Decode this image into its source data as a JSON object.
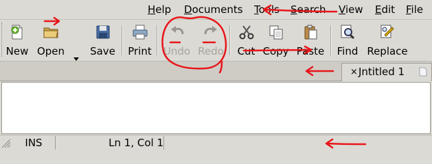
{
  "menubar": {
    "items": [
      {
        "label": "Help",
        "mnemonic": "H",
        "rest": "elp"
      },
      {
        "label": "Documents",
        "mnemonic": "D",
        "rest": "ocuments"
      },
      {
        "label": "Tools",
        "mnemonic": "T",
        "rest": "ools"
      },
      {
        "label": "Search",
        "mnemonic": "S",
        "rest": "earch"
      },
      {
        "label": "View",
        "mnemonic": "V",
        "rest": "iew"
      },
      {
        "label": "Edit",
        "mnemonic": "E",
        "rest": "dit"
      },
      {
        "label": "File",
        "mnemonic": "F",
        "rest": "ile"
      }
    ]
  },
  "toolbar": {
    "new_label": "New",
    "open_label": "Open",
    "save_label": "Save",
    "print_label": "Print",
    "undo_label": "Undo",
    "redo_label": "Redo",
    "cut_label": "Cut",
    "copy_label": "Copy",
    "paste_label": "Paste",
    "find_label": "Find",
    "replace_label": "Replace"
  },
  "tab": {
    "close_glyph": "×",
    "title": "Jntitled 1"
  },
  "statusbar": {
    "mode": "INS",
    "position": "Ln 1, Col 1"
  },
  "colors": {
    "annotation": "#e8161a",
    "window_bg": "#dcdad5",
    "editor_bg": "#ffffff",
    "disabled_text": "#a7a49c"
  },
  "icons": [
    "new-document-icon",
    "open-folder-icon",
    "dropdown-arrow-icon",
    "save-disk-icon",
    "printer-icon",
    "undo-icon",
    "redo-icon",
    "cut-scissors-icon",
    "copy-icon",
    "paste-clipboard-icon",
    "find-magnifier-icon",
    "replace-icon",
    "tab-close-icon",
    "tab-document-icon",
    "resize-grip-icon"
  ]
}
